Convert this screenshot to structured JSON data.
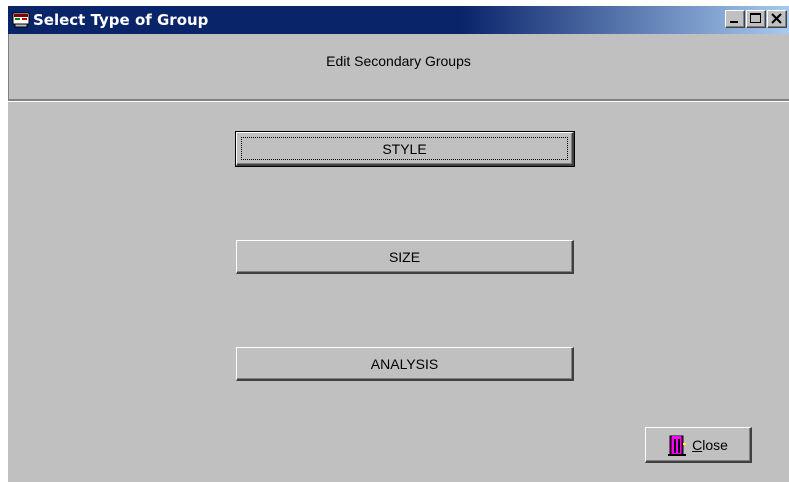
{
  "window": {
    "title": "Select Type of Group",
    "header_text": "Edit Secondary Groups"
  },
  "buttons": {
    "style": "STYLE",
    "size": "SIZE",
    "analysis": "ANALYSIS"
  },
  "close_button": {
    "mnemonic": "C",
    "rest": "lose",
    "icon": "exit-door-icon"
  },
  "colors": {
    "title_bar": "#0a246a",
    "title_bar_end": "#a6caf0",
    "face": "#c0c0c0"
  }
}
